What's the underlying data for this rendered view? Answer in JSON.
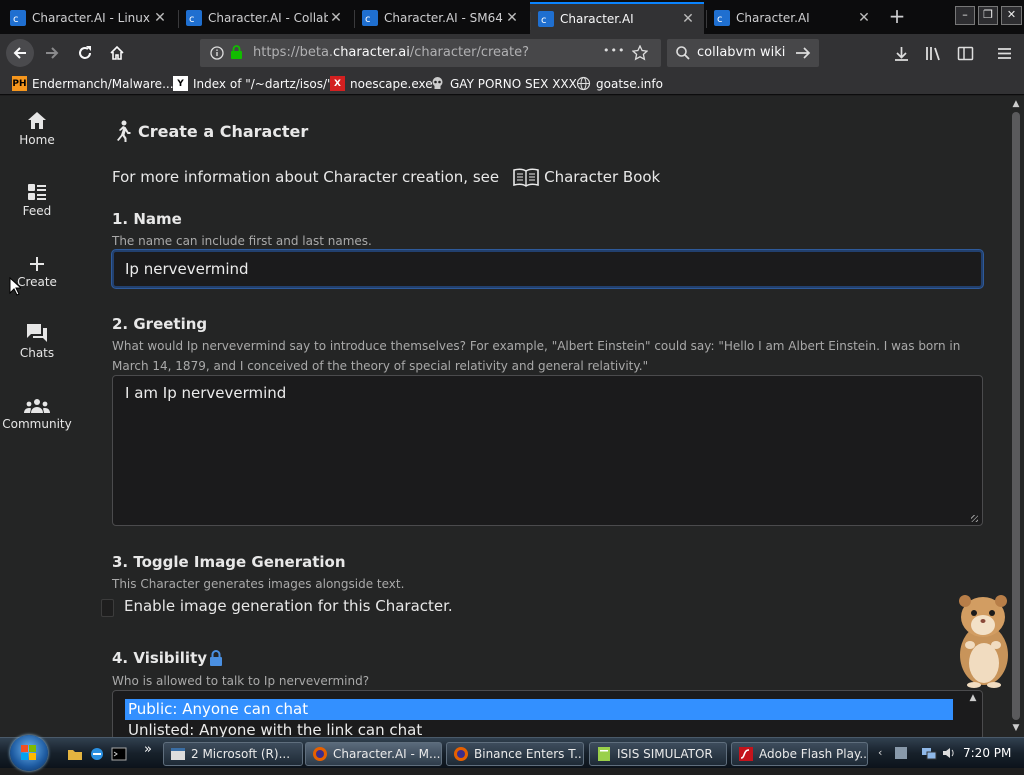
{
  "browser": {
    "tabs": [
      {
        "title": "Character.AI - Linux",
        "active": false
      },
      {
        "title": "Character.AI - Collab",
        "active": false
      },
      {
        "title": "Character.AI - SM64",
        "active": false
      },
      {
        "title": "Character.AI",
        "active": true
      },
      {
        "title": "Character.AI",
        "active": false
      }
    ],
    "new_tab_glyph": "+",
    "close_glyph": "✕",
    "url_prefix": "https://beta.",
    "url_domain": "character.ai",
    "url_path": "/character/create?",
    "page_actions_glyph": "•••",
    "search_query": "collabvm wiki",
    "bookmarks": [
      {
        "label": "Endermanch/Malware...",
        "icon": "PH"
      },
      {
        "label": "Index of \"/~dartz/isos/\"",
        "icon": "Y"
      },
      {
        "label": "noescape.exe",
        "icon": "X"
      },
      {
        "label": "GAY PORNO SEX XXX",
        "icon": "skull-icon"
      },
      {
        "label": "goatse.info",
        "icon": "globe-icon"
      }
    ]
  },
  "sidebar": {
    "items": [
      {
        "label": "Home",
        "icon": "home-icon"
      },
      {
        "label": "Feed",
        "icon": "feed-icon"
      },
      {
        "label": "Create",
        "icon": "plus-icon"
      },
      {
        "label": "Chats",
        "icon": "chat-icon"
      },
      {
        "label": "Community",
        "icon": "community-icon"
      }
    ]
  },
  "form": {
    "title": "Create a Character",
    "info_text": "For more information about Character creation, see",
    "book_link": "Character Book",
    "name": {
      "heading": "1. Name",
      "help": "The name can include first and last names.",
      "value": "Ip nervevermind"
    },
    "greeting": {
      "heading": "2. Greeting",
      "help": "What would Ip nervevermind say to introduce themselves? For example, \"Albert Einstein\" could say: \"Hello I am Albert Einstein. I was born in March 14, 1879, and I conceived of the theory of special relativity and general relativity.\"",
      "value": "I am Ip nervevermind"
    },
    "image_gen": {
      "heading": "3. Toggle Image Generation",
      "help": "This Character generates images alongside text.",
      "checkbox_label": "Enable image generation for this Character.",
      "checked": false
    },
    "visibility": {
      "heading": "4. Visibility",
      "help": "Who is allowed to talk to Ip nervevermind?",
      "options": [
        "Public: Anyone can chat",
        "Unlisted: Anyone with the link can chat"
      ],
      "selected": "Public: Anyone can chat"
    }
  },
  "taskbar": {
    "overflow_glyph": "»",
    "buttons": [
      {
        "label": "2 Microsoft (R)...",
        "active": false
      },
      {
        "label": "Character.AI - M...",
        "active": true
      },
      {
        "label": "Binance Enters T...",
        "active": false
      },
      {
        "label": "ISIS SIMULATOR",
        "active": false
      },
      {
        "label": "Adobe Flash Play...",
        "active": false
      }
    ],
    "clock": "7:20 PM"
  },
  "colors": {
    "accent_blue": "#0a84ff",
    "page_bg": "#242525",
    "selection_blue": "#3390ff",
    "lock_blue": "#4a90e2"
  }
}
